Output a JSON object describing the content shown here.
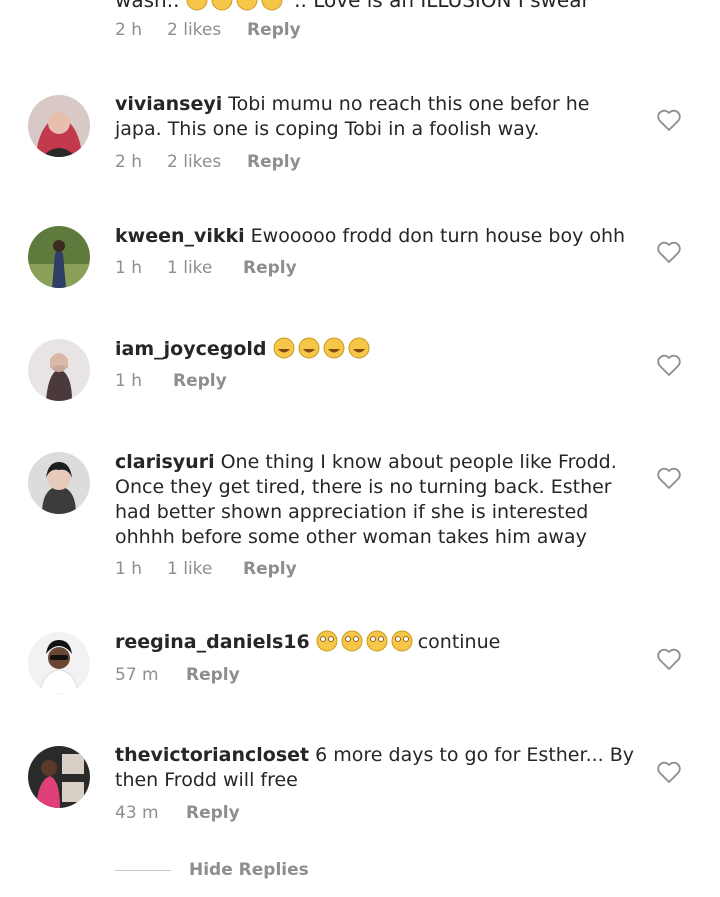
{
  "partial_comment": {
    "text_start": "wash..",
    "text_end": ".. Love is an ILLUSION I swear",
    "time": "2 h",
    "likes": "2 likes",
    "reply": "Reply"
  },
  "comments": [
    {
      "username": "vivianseyi",
      "text": "Tobi mumu no reach this one befor he japa. This one is coping Tobi in a foolish way.",
      "time": "2 h",
      "likes": "2 likes",
      "reply": "Reply"
    },
    {
      "username": "kween_vikki",
      "text": "Ewooooo frodd don turn house boy ohh",
      "time": "1 h",
      "likes": "1 like",
      "reply": "Reply"
    },
    {
      "username": "iam_joycegold",
      "text": "",
      "emoji": "grinning-sweat-emoji",
      "time": "1 h",
      "reply": "Reply"
    },
    {
      "username": "clarisyuri",
      "text": "One thing I know about people like Frodd. Once they get tired, there is no turning back. Esther had better shown appreciation if she is interested ohhhh before some other woman takes him away",
      "time": "1 h",
      "likes": "1 like",
      "reply": "Reply"
    },
    {
      "username": "reegina_daniels16",
      "text": "continue",
      "emoji": "eye-roll-emoji",
      "time": "57 m",
      "reply": "Reply"
    },
    {
      "username": "thevictoriancloset",
      "text": "6 more days to go for Esther... By then Frodd will free",
      "time": "43 m",
      "reply": "Reply"
    }
  ],
  "hide_replies": "Hide Replies",
  "colors": {
    "text": "#262626",
    "meta": "#8e8e8e",
    "heart_outline": "#8e8e8e",
    "emoji_yellow": "#f6c648"
  },
  "icons": {
    "like": "heart-outline-icon"
  }
}
